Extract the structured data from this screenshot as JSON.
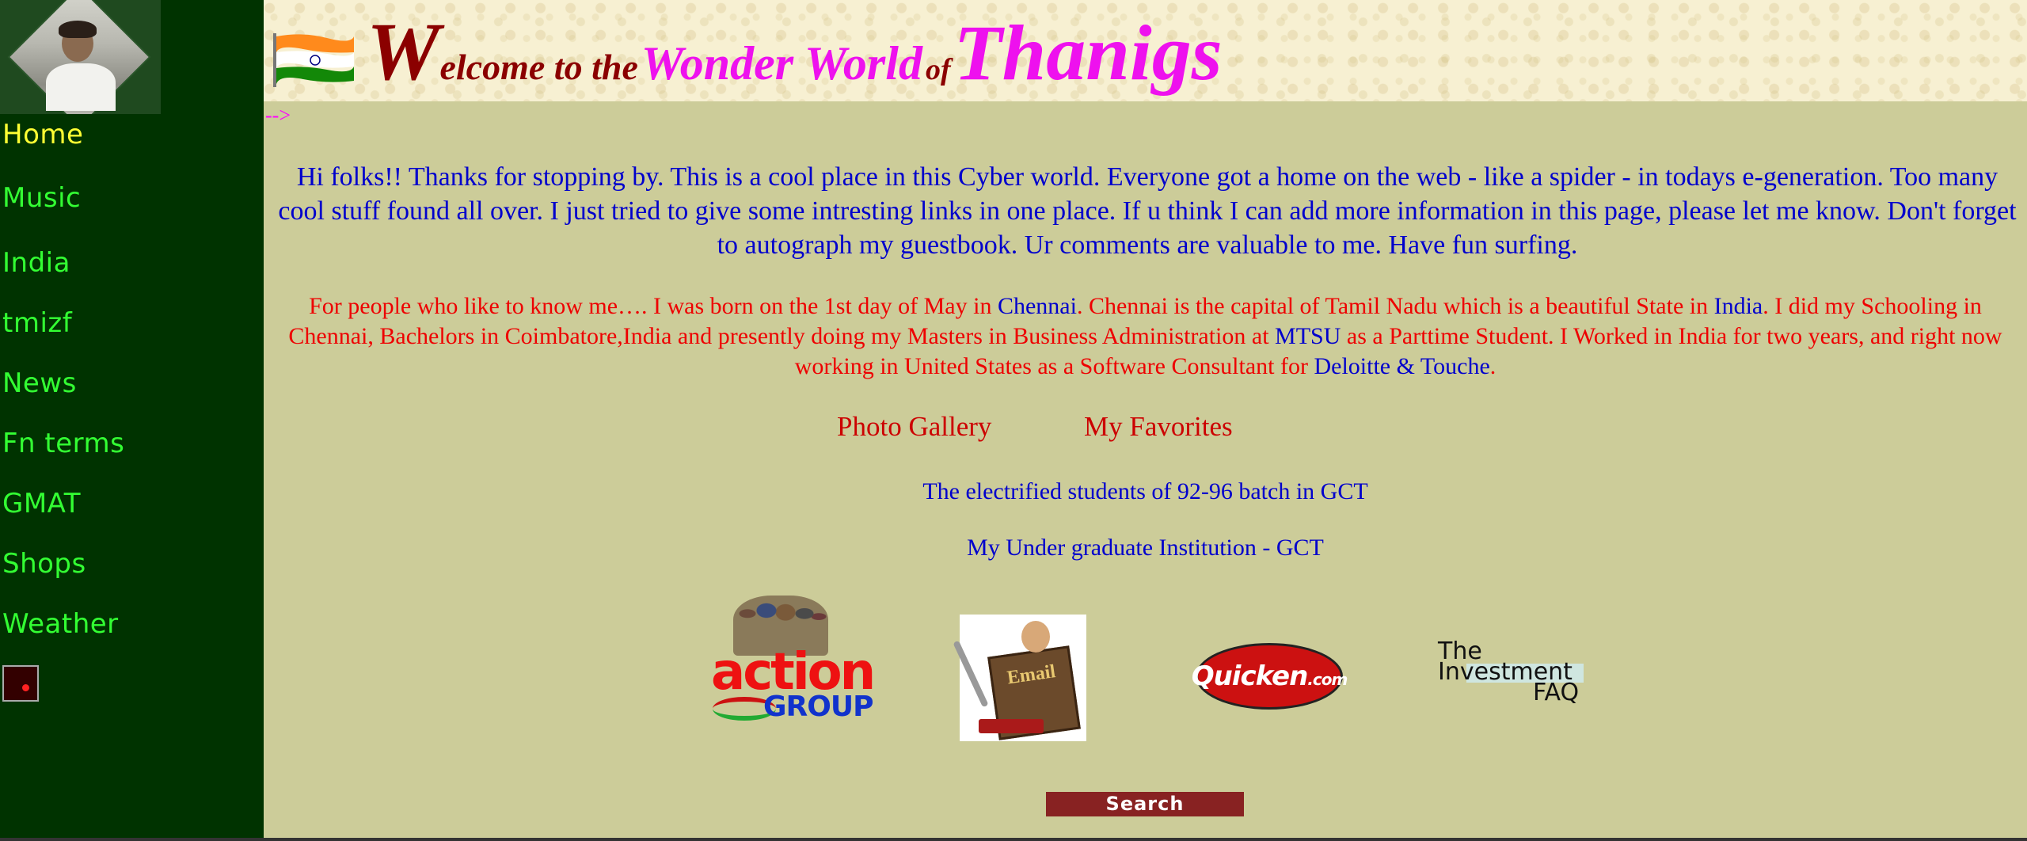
{
  "sidebar": {
    "items": [
      {
        "label": "Home",
        "active": true
      },
      {
        "label": "Music"
      },
      {
        "label": "India"
      },
      {
        "label": "tmizf"
      },
      {
        "label": "News"
      },
      {
        "label": "Fn terms"
      },
      {
        "label": "GMAT"
      },
      {
        "label": "Shops"
      },
      {
        "label": "Weather"
      }
    ]
  },
  "header": {
    "title_w": "W",
    "title_elcome": "elcome to the",
    "title_wonder": "Wonder World",
    "title_of": "of",
    "title_name": "Thanigs"
  },
  "comment_artifact": "-->",
  "intro_text": "Hi folks!! Thanks for stopping by. This is a cool place in this Cyber world. Everyone got a home on the web - like a spider - in todays e-generation. Too many cool stuff found all over. I just tried to give some intresting links in one place. If u think I can add more information in this page, please let me know. Don't forget to autograph my guestbook. Ur comments are valuable to me. Have fun surfing.",
  "about": {
    "part1": "For people who like to know me…. I was born on the 1st day of May in ",
    "link_chennai": "Chennai",
    "part2": ". Chennai is the capital of Tamil Nadu which is a beautiful State in ",
    "link_india": "India",
    "part3": ". I did my Schooling in Chennai, Bachelors in Coimbatore,India and presently doing my Masters in Business Administration at ",
    "link_mtsu": "MTSU",
    "part4": " as a Parttime Student. I Worked in India for two years, and right now working in United States as a Software Consultant for ",
    "link_deloitte": "Deloitte & Touche",
    "part5": "."
  },
  "links": {
    "photo_gallery": "Photo Gallery",
    "my_favorites": "My Favorites",
    "electrified": "The electrified students of 92-96 batch in GCT",
    "institution": "My Under graduate Institution - GCT"
  },
  "logos": {
    "action_top": "action",
    "action_bottom": "GROUP",
    "book_text": "Email",
    "quicken": "Quicken",
    "quicken_suffix": ".com",
    "invest_line1": "The",
    "invest_line2": "Investment",
    "invest_line3": "FAQ"
  },
  "search_label": "Search",
  "colors": {
    "sidebar_bg": "#003300",
    "nav_link": "#33ff33",
    "nav_active": "#ffff33",
    "page_bg": "#cccc99",
    "intro_text": "#0000cc",
    "about_text": "#ee0000",
    "title_red": "#8b0000",
    "title_magenta": "#ee11ee",
    "search_bg": "#882222"
  }
}
